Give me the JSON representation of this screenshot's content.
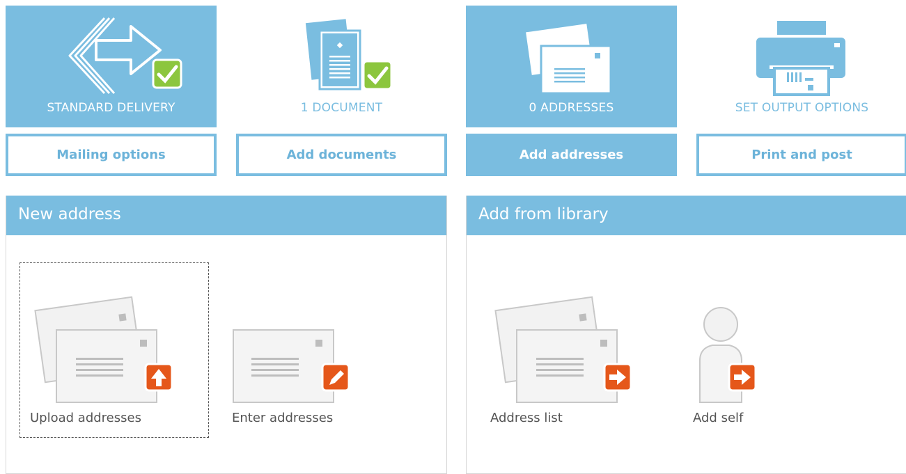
{
  "steps": [
    {
      "label": "STANDARD DELIVERY",
      "button": "Mailing options",
      "active": true,
      "done": true
    },
    {
      "label": "1 DOCUMENT",
      "button": "Add documents",
      "active": false,
      "done": true
    },
    {
      "label": "0 ADDRESSES",
      "button": "Add addresses",
      "active": true,
      "done": false
    },
    {
      "label": "SET OUTPUT OPTIONS",
      "button": "Print and post",
      "active": false,
      "done": false
    }
  ],
  "new_address": {
    "title": "New address",
    "options": [
      {
        "label": "Upload addresses",
        "badge": "upload-arrow-icon"
      },
      {
        "label": "Enter addresses",
        "badge": "pencil-icon"
      }
    ]
  },
  "library": {
    "title": "Add from library",
    "options": [
      {
        "label": "Address list",
        "badge": "arrow-right-icon"
      },
      {
        "label": "Add self",
        "badge": "arrow-right-icon"
      }
    ]
  },
  "colors": {
    "accent": "#7abde0",
    "check": "#8cc63e",
    "badge": "#e5571a"
  }
}
